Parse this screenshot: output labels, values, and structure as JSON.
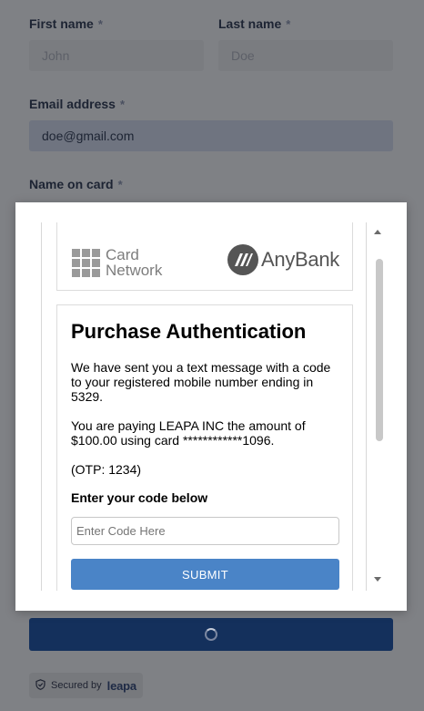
{
  "form": {
    "first_name_label": "First name",
    "first_name_placeholder": "John",
    "last_name_label": "Last name",
    "last_name_placeholder": "Doe",
    "email_label": "Email address",
    "email_value": "doe@gmail.com",
    "name_on_card_label": "Name on card",
    "required_mark": "*"
  },
  "secured": {
    "label": "Secured by",
    "brand": "leapa"
  },
  "modal": {
    "card_network_line1": "Card",
    "card_network_line2": "Network",
    "bank_name": "AnyBank",
    "title": "Purchase Authentication",
    "message": "We have sent you a text message with a code to your registered mobile number ending in 5329.",
    "payment_info": "You are paying LEAPA INC the amount of $100.00 using card ************1096.",
    "otp": "(OTP: 1234)",
    "enter_code_label": "Enter your code below",
    "code_placeholder": "Enter Code Here",
    "submit_label": "SUBMIT"
  },
  "colors": {
    "overlay": "#7f8185",
    "submit": "#4a84c7",
    "pay_button": "#14305c"
  },
  "icons": {
    "shield": "shield-check-icon",
    "spinner": "loading-spinner-icon"
  }
}
